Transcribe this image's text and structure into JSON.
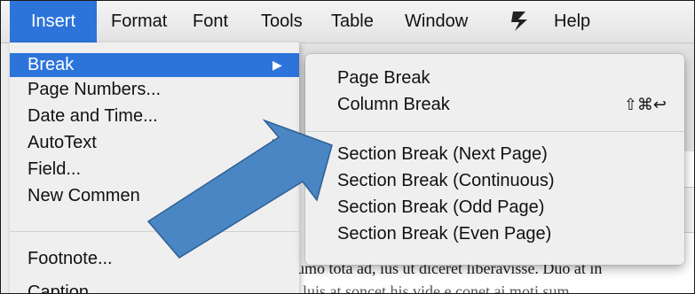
{
  "menubar": {
    "items": [
      "Insert",
      "Format",
      "Font",
      "Tools",
      "Table",
      "Window",
      "Help"
    ],
    "script_icon": "script-menu-icon"
  },
  "insert_menu": {
    "items": [
      {
        "label": "Break",
        "has_submenu": true,
        "highlighted": true
      },
      {
        "label": "Page Numbers..."
      },
      {
        "label": "Date and Time..."
      },
      {
        "label": "AutoText",
        "has_submenu": true
      },
      {
        "label": "Field..."
      },
      {
        "label": "New Commen"
      },
      {
        "label": "Footnote..."
      },
      {
        "label": "Caption"
      }
    ],
    "arrow": "▶"
  },
  "break_submenu": {
    "items": [
      {
        "label": "Page Break"
      },
      {
        "label": "Column Break",
        "shortcut": "⇧⌘↩"
      },
      {
        "label": "Section Break (Next Page)"
      },
      {
        "label": "Section Break (Continuous)"
      },
      {
        "label": "Section Break (Odd Page)"
      },
      {
        "label": "Section Break (Even Page)"
      }
    ]
  },
  "document": {
    "line1": "umo tota ad, ius ut diceret liberavisse. Duo at in",
    "line2": "luis at soncet his vide e conet ai moti sum"
  },
  "colors": {
    "highlight": "#2d74da",
    "callout_arrow": "#4a86c4"
  }
}
